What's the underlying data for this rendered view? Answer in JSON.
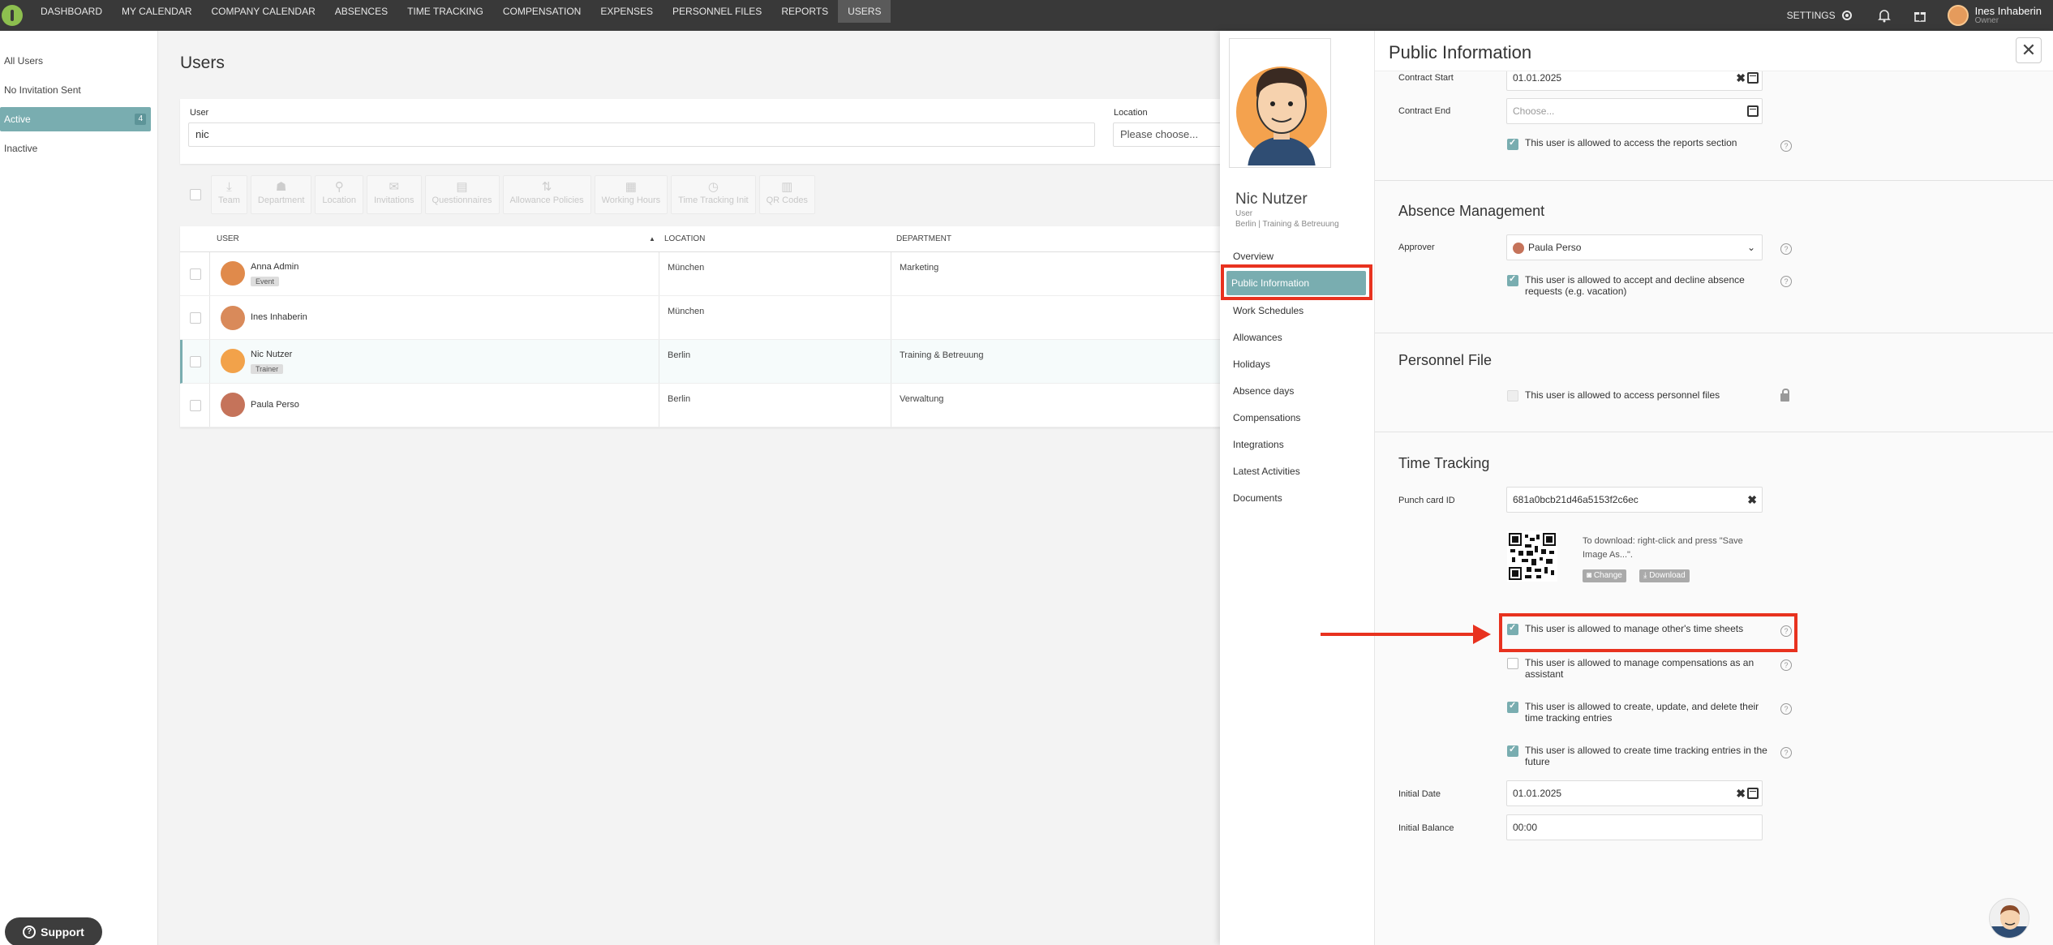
{
  "nav": {
    "items": [
      "DASHBOARD",
      "MY CALENDAR",
      "COMPANY CALENDAR",
      "ABSENCES",
      "TIME TRACKING",
      "COMPENSATION",
      "EXPENSES",
      "PERSONNEL FILES",
      "REPORTS",
      "USERS"
    ],
    "settings_label": "SETTINGS",
    "user_name": "Ines Inhaberin",
    "user_role": "Owner"
  },
  "sidebar": {
    "filters": [
      {
        "label": "All Users"
      },
      {
        "label": "No Invitation Sent"
      },
      {
        "label": "Active",
        "count": "4"
      },
      {
        "label": "Inactive"
      }
    ]
  },
  "main": {
    "title": "Users",
    "user_label": "User",
    "user_value": "nic",
    "location_label": "Location",
    "location_placeholder": "Please choose...",
    "toolbar": [
      "Team",
      "Department",
      "Location",
      "Invitations",
      "Questionnaires",
      "Allowance Policies",
      "Working Hours",
      "Time Tracking Init",
      "QR Codes"
    ],
    "columns": [
      "USER",
      "LOCATION",
      "DEPARTMENT"
    ],
    "rows": [
      {
        "name": "Anna Admin",
        "badge": "Event",
        "location": "München",
        "department": "Marketing"
      },
      {
        "name": "Ines Inhaberin",
        "badge": "",
        "location": "München",
        "department": ""
      },
      {
        "name": "Nic Nutzer",
        "badge": "Trainer",
        "location": "Berlin",
        "department": "Training & Betreuung"
      },
      {
        "name": "Paula Perso",
        "badge": "",
        "location": "Berlin",
        "department": "Verwaltung"
      }
    ]
  },
  "panel": {
    "name": "Nic Nutzer",
    "role": "User",
    "location_dept": "Berlin | Training & Betreuung",
    "nav": [
      "Overview",
      "Public Information",
      "Work Schedules",
      "Allowances",
      "Holidays",
      "Absence days",
      "Compensations",
      "Integrations",
      "Latest Activities",
      "Documents"
    ],
    "title": "Public Information",
    "contract_start_label": "Contract Start",
    "contract_start_value": "01.01.2025",
    "contract_end_label": "Contract End",
    "contract_end_placeholder": "Choose...",
    "reports_access": "This user is allowed to access the reports section",
    "absence_title": "Absence Management",
    "approver_label": "Approver",
    "approver_value": "Paula Perso",
    "absence_perm": "This user is allowed to accept and decline absence requests (e.g. vacation)",
    "personnel_title": "Personnel File",
    "personnel_perm": "This user is allowed to access personnel files",
    "time_title": "Time Tracking",
    "punch_label": "Punch card ID",
    "punch_value": "681a0bcb21d46a5153f2c6ec",
    "qr_note": "To download: right-click and press \"Save Image As...\".",
    "change_btn": "Change",
    "download_btn": "Download",
    "perm_timesheets": "This user is allowed to manage other's time sheets",
    "perm_comp": "This user is allowed to manage compensations as an assistant",
    "perm_crud": "This user is allowed to create, update, and delete their time tracking entries",
    "perm_future": "This user is allowed to create time tracking entries in the future",
    "initial_date_label": "Initial Date",
    "initial_date_value": "01.01.2025",
    "initial_balance_label": "Initial Balance",
    "initial_balance_value": "00:00"
  },
  "support_label": "Support",
  "colors": {
    "accent": "#79adb0",
    "highlight": "#e8321f",
    "topbar": "#393939"
  }
}
